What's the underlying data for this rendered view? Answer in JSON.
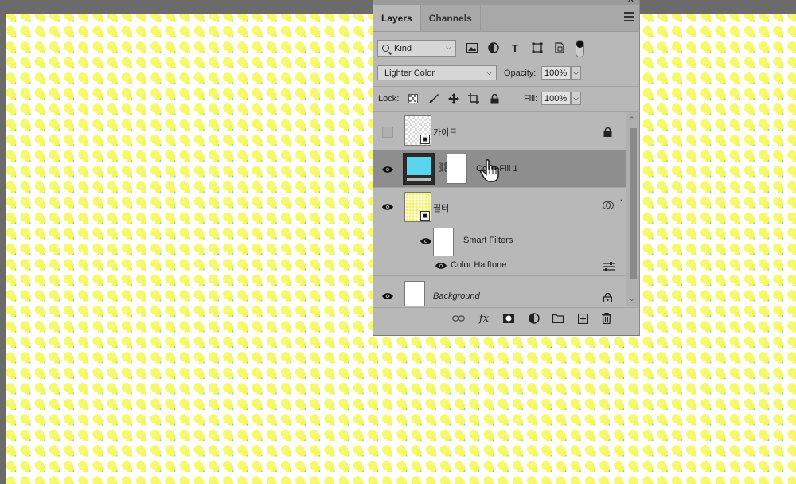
{
  "panel": {
    "tabs": [
      {
        "label": "Layers",
        "active": true
      },
      {
        "label": "Channels",
        "active": false
      }
    ],
    "filter": {
      "kind_label": "Kind"
    },
    "blend": {
      "mode": "Lighter Color",
      "opacity_label": "Opacity:",
      "opacity_value": "100%"
    },
    "lock": {
      "label": "Lock:",
      "fill_label": "Fill:",
      "fill_value": "100%"
    },
    "layers": [
      {
        "name": "가이드",
        "visible": false,
        "locked": true,
        "type": "smart-object"
      },
      {
        "name": "Color Fill 1",
        "visible": true,
        "selected": true,
        "type": "fill",
        "color": "#5bd4ee"
      },
      {
        "name": "필터",
        "visible": true,
        "type": "smart-object",
        "smart_filters_label": "Smart Filters",
        "filters": [
          {
            "name": "Color Halftone"
          }
        ]
      },
      {
        "name": "Background",
        "visible": true,
        "locked": true,
        "type": "background"
      }
    ]
  },
  "canvas": {
    "dot_color": "#f5f75a",
    "accent_color": "#5fc8e6"
  }
}
